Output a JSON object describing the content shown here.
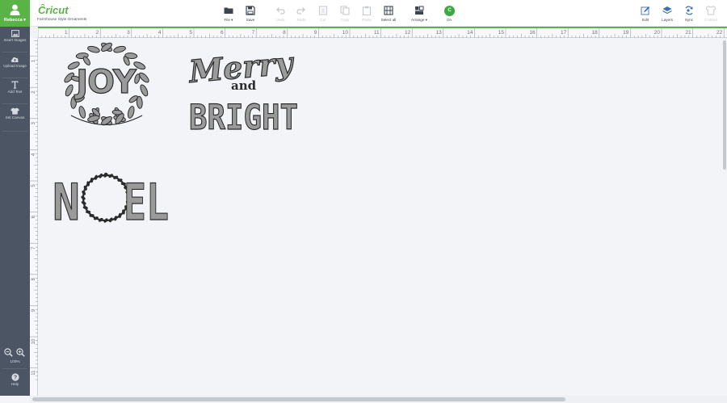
{
  "user": {
    "name": "Rebecca ▾"
  },
  "sidebar": {
    "items": [
      {
        "label": "Insert Images",
        "icon": "image-icon"
      },
      {
        "label": "Upload Image",
        "icon": "cloud-upload-icon"
      },
      {
        "label": "Add Text",
        "icon": "text-icon"
      },
      {
        "label": "Set Canvas",
        "icon": "tshirt-icon"
      }
    ],
    "zoom_level": "100%",
    "help_label": "Help"
  },
  "toolbar": {
    "logo_text": "Cricut",
    "project_name": "Farmhouse Style Ornaments",
    "buttons": [
      {
        "label": "File ▾",
        "icon": "folder-icon",
        "enabled": true
      },
      {
        "label": "Save",
        "icon": "save-icon",
        "enabled": true
      },
      {
        "label": "Undo",
        "icon": "undo-icon",
        "enabled": false
      },
      {
        "label": "Redo",
        "icon": "redo-icon",
        "enabled": false
      },
      {
        "label": "Cut",
        "icon": "cut-icon",
        "enabled": false
      },
      {
        "label": "Copy",
        "icon": "copy-icon",
        "enabled": false
      },
      {
        "label": "Paste",
        "icon": "paste-icon",
        "enabled": false
      },
      {
        "label": "Select all",
        "icon": "select-all-icon",
        "enabled": true
      },
      {
        "label": "Arrange ▾",
        "icon": "arrange-icon",
        "enabled": true
      }
    ],
    "machine": {
      "letter": "C",
      "label": "On"
    },
    "right_buttons": [
      {
        "label": "Edit",
        "icon": "pencil-icon",
        "enabled": true
      },
      {
        "label": "Layers",
        "icon": "layers-icon",
        "enabled": true
      },
      {
        "label": "Sync",
        "icon": "sync-icon",
        "enabled": true
      },
      {
        "label": "Contour",
        "icon": "contour-icon",
        "enabled": false
      }
    ]
  },
  "ruler": {
    "top_numbers": [
      "1",
      "2",
      "3",
      "4",
      "5",
      "6",
      "7",
      "8",
      "9",
      "10",
      "11",
      "12",
      "13",
      "14",
      "15",
      "16",
      "17",
      "18",
      "19",
      "20",
      "21",
      "22"
    ],
    "left_numbers": [
      "1",
      "2",
      "3",
      "4",
      "5",
      "6",
      "7",
      "8",
      "9",
      "10",
      "11"
    ]
  },
  "canvas": {
    "joy_text": "JOY",
    "merry_text": "Merry",
    "and_text": "and",
    "bright_text": "BRIGHT",
    "noel_n": "N",
    "noel_el": "EL"
  },
  "colors": {
    "brand_green": "#5ab346",
    "sidebar_bg": "#4b5563",
    "design_fill": "#9a9a9a",
    "design_stroke": "#2b2b2b"
  }
}
